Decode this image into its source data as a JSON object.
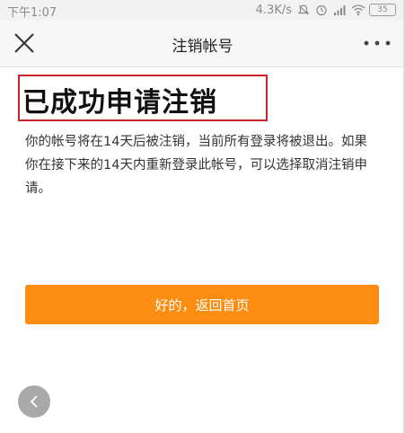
{
  "status_bar": {
    "time": "下午1:07",
    "net_speed": "4.3K/s",
    "battery_level": "35",
    "icons": [
      "mute-icon",
      "alarm-icon",
      "signal-icon",
      "wifi-icon",
      "battery-icon"
    ]
  },
  "nav": {
    "title": "注销帐号",
    "close_icon": "close-icon",
    "more_icon": "more-icon"
  },
  "main": {
    "headline": "已成功申请注销",
    "description": "你的帐号将在14天后被注销，当前所有登录将被退出。如果你在接下来的14天内重新登录此帐号，可以选择取消注销申请。",
    "primary_button_label": "好的，返回首页"
  },
  "colors": {
    "accent": "#fb8d13",
    "highlight_box": "#c8232b",
    "status_text": "#8a8a8a"
  }
}
